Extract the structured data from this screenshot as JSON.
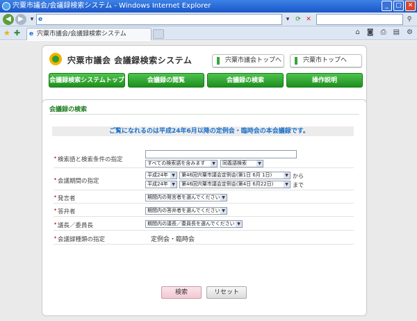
{
  "window": {
    "title": "宍粟市議会/会議録検索システム - Windows Internet Explorer",
    "minimize": "_",
    "maximize": "□",
    "close": "✕"
  },
  "browser": {
    "address_icon": "e",
    "tab_label": "宍粟市議会/会議録検索システム",
    "tab_icon": "e"
  },
  "header": {
    "site_title": "宍粟市議会 会議録検索システム",
    "top_links": [
      "宍粟市議会トップへ",
      "宍粟市トップへ"
    ],
    "nav": [
      "会議録検索システムトップ",
      "会議録の閲覧",
      "会議録の検索",
      "操作説明"
    ]
  },
  "panel": {
    "title": "会議録の検索",
    "notice": "ご覧になれるのは平成24年6月以降の定例会・臨時会の本会議録です。"
  },
  "form": {
    "keyword": {
      "label": "検索語と検索条件の指定",
      "value": "",
      "condition": "すべての検索語を含みます",
      "match": "同義語検索"
    },
    "period": {
      "label": "会議期間の指定",
      "from_year": "平成24年",
      "from_session": "第46回宍粟市議会定例会(第1日 6月 1日)",
      "from_suffix": "から",
      "to_year": "平成24年",
      "to_session": "第46回宍粟市議会定例会(第4日 6月22日)",
      "to_suffix": "まで"
    },
    "speaker": {
      "label": "発言者",
      "value": "期間内の発言者を選んでください"
    },
    "answerer": {
      "label": "答弁者",
      "value": "期間内の答弁者を選んでください"
    },
    "chair": {
      "label": "議長／委員長",
      "value": "期間内の議長／委員長を選んでください"
    },
    "meeting_type": {
      "label": "会議録種類の指定",
      "value": "定例会・臨時会"
    },
    "search_button": "検索",
    "reset_button": "リセット"
  },
  "colors": {
    "accent_green": "#1e8f1e",
    "notice_blue": "#1b6fc8",
    "label_bullet": "#cc3333"
  }
}
